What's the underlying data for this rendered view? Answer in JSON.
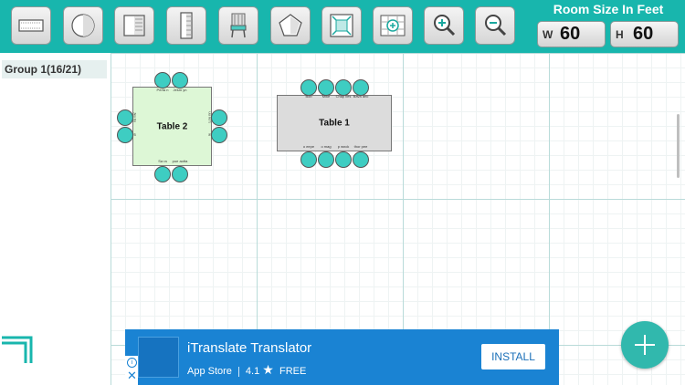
{
  "toolbar": {
    "buttons": [
      {
        "name": "rectangle-table-icon"
      },
      {
        "name": "round-table-icon"
      },
      {
        "name": "square-table-icon"
      },
      {
        "name": "long-table-icon"
      },
      {
        "name": "chair-icon"
      },
      {
        "name": "pentagon-icon"
      },
      {
        "name": "fit-screen-icon"
      },
      {
        "name": "grid-add-icon"
      },
      {
        "name": "zoom-in-icon"
      },
      {
        "name": "zoom-out-icon"
      }
    ],
    "room_size_title": "Room Size In Feet",
    "width_label": "W",
    "width_value": "60",
    "height_label": "H",
    "height_value": "60"
  },
  "sidebar": {
    "group_label": "Group 1(16/21)"
  },
  "tables": [
    {
      "name": "Table 2",
      "color": "#ddf7d6",
      "top_seats": [
        "Perfa n",
        "Jesm yn"
      ],
      "bottom_seats": [
        "Sa ra",
        "pue aotta"
      ],
      "left_seats": [
        "Jes tis",
        "ol"
      ],
      "right_seats": [
        "Lou nn",
        "ie"
      ]
    },
    {
      "name": "Table 1",
      "color": "#dcdcdc",
      "top_seats": [
        "Bob",
        "Mike",
        "Chap lies",
        "Bava anc"
      ],
      "bottom_seats": [
        "o eepe",
        "o mag",
        "p wnck",
        "thor pee"
      ]
    }
  ],
  "ad": {
    "title": "iTranslate Translator",
    "store": "App Store",
    "rating": "4.1",
    "star": "★",
    "price": "FREE",
    "install_label": "INSTALL",
    "info_glyph": "i",
    "close_glyph": "✕"
  },
  "colors": {
    "toolbar": "#18b6ad",
    "chair": "#3ecdc2",
    "fab": "#31b8ad",
    "ad_background": "#1a83d3"
  }
}
